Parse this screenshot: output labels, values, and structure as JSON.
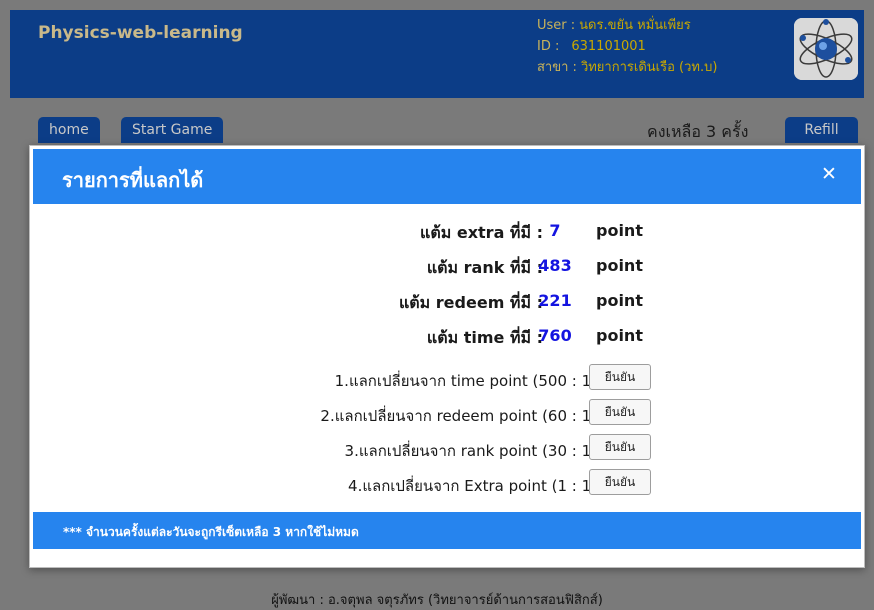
{
  "app": {
    "brand": "Physics-web-learning",
    "user_label": "User :",
    "user_name": "นดร.ขยัน หมั่นเพียร",
    "id_label": "ID :",
    "id_value": "631101001",
    "branch_label": "สาขา :",
    "branch_value": "วิทยาการเดินเรือ (วท.บ)",
    "avatar_icon": "atom-logo"
  },
  "nav": {
    "home": "home",
    "start_game": "Start Game",
    "remaining": "คงเหลือ 3 ครั้ง",
    "refill": "Refill"
  },
  "modal": {
    "title": "รายการที่แลกได้",
    "close_icon": "close-icon",
    "points": [
      {
        "label": "แต้ม extra ที่มี :",
        "value": "7",
        "unit": "point"
      },
      {
        "label": "แต้ม rank ที่มี :",
        "value": "483",
        "unit": "point"
      },
      {
        "label": "แต้ม redeem ที่มี :",
        "value": "221",
        "unit": "point"
      },
      {
        "label": "แต้ม time ที่มี :",
        "value": "760",
        "unit": "point"
      }
    ],
    "exchanges": [
      {
        "label": "1.แลกเปลี่ยนจาก time point (500 : 1)",
        "button": "ยืนยัน"
      },
      {
        "label": "2.แลกเปลี่ยนจาก redeem point (60 : 1)",
        "button": "ยืนยัน"
      },
      {
        "label": "3.แลกเปลี่ยนจาก rank point (30 : 1)",
        "button": "ยืนยัน"
      },
      {
        "label": "4.แลกเปลี่ยนจาก Extra point (1 : 1)",
        "button": "ยืนยัน"
      }
    ],
    "note": "*** จำนวนครั้งแต่ละวันจะถูกรีเซ็ตเหลือ 3 หากใช้ไม่หมด"
  },
  "footer": {
    "credit": "ผู้พัฒนา : อ.จตุพล จตุรภัทร (วิทยาจารย์ด้านการสอนฟิสิกส์)"
  },
  "colors": {
    "header_dark": "#0c3d87",
    "modal_blue": "#2684ee",
    "value_blue": "#1414e0",
    "overlay": "#7a7a7a"
  }
}
